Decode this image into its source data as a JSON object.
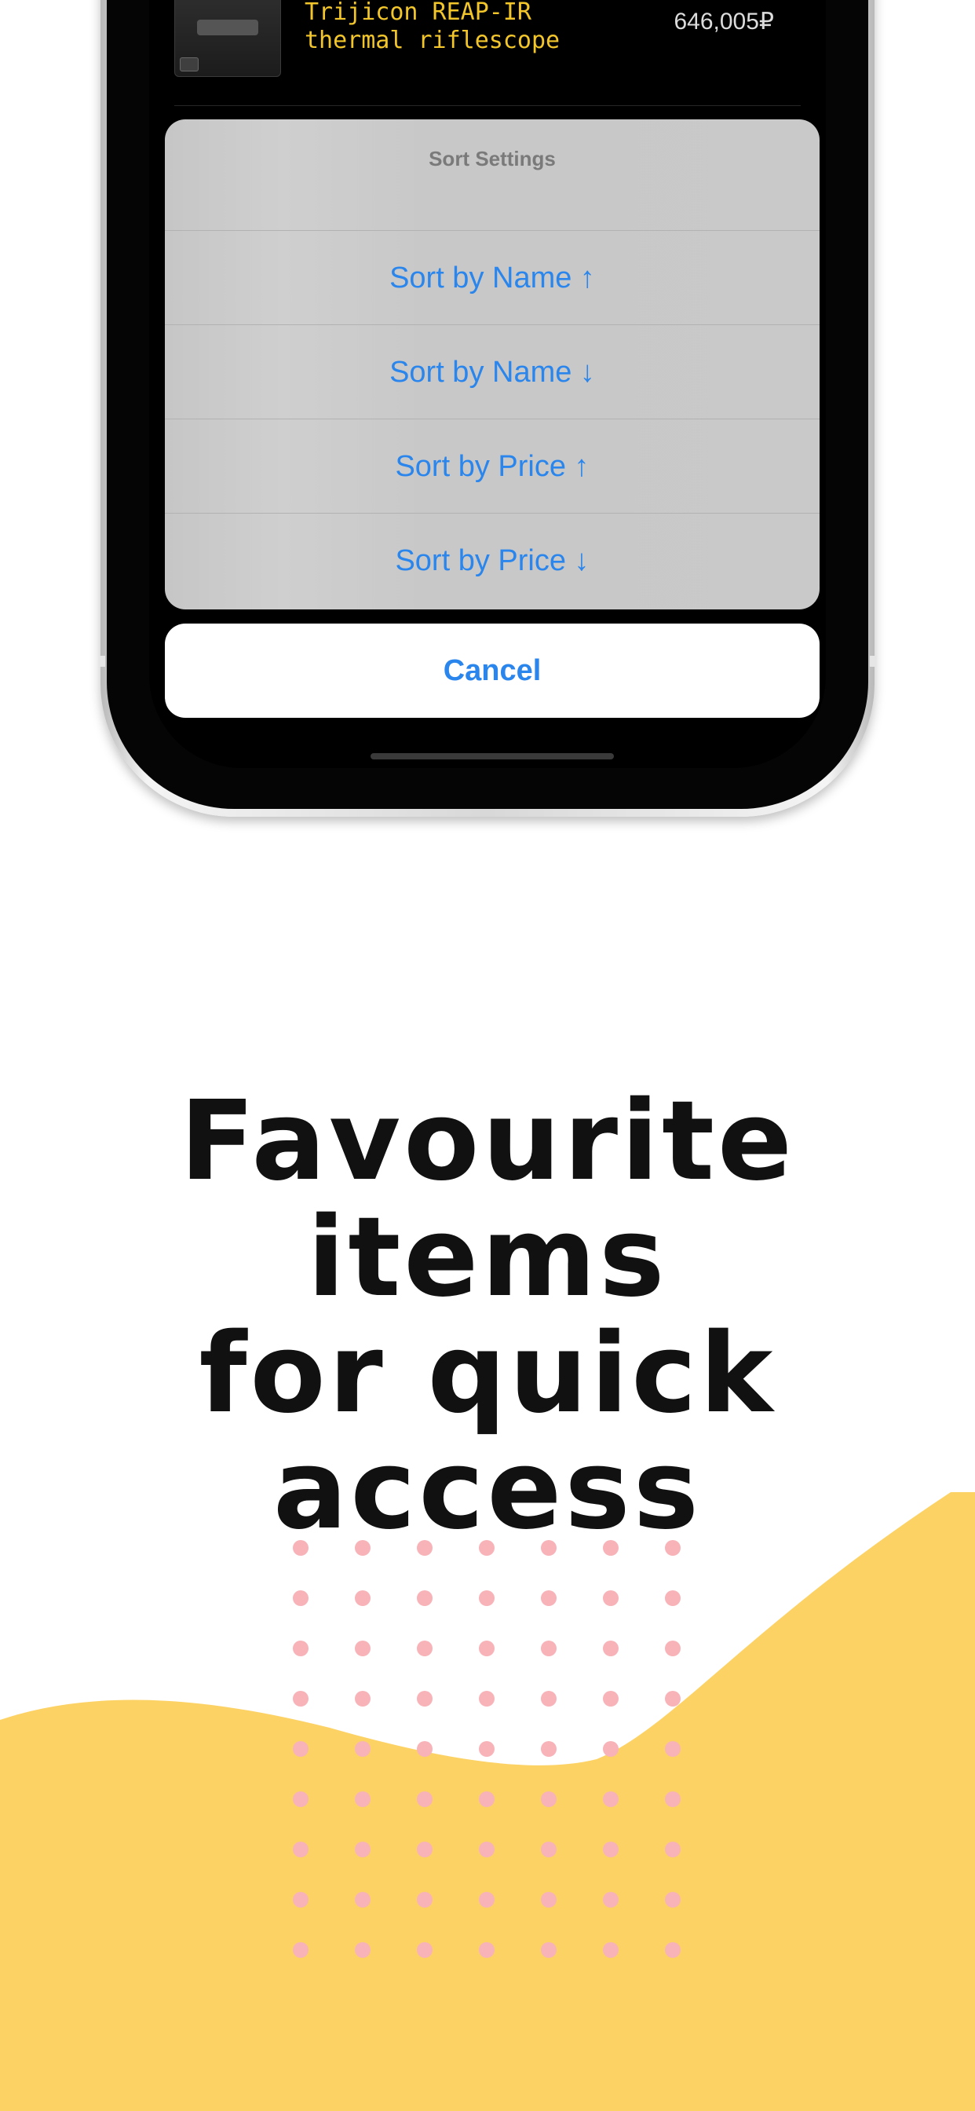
{
  "list_item": {
    "name": "Trijicon REAP-IR thermal riflescope",
    "price": "646,005₽"
  },
  "sort_sheet": {
    "title": "Sort Settings",
    "options": [
      "Sort by Name ↑",
      "Sort by Name ↓",
      "Sort by Price ↑",
      "Sort by Price ↓"
    ],
    "cancel_label": "Cancel"
  },
  "headline": {
    "line1": "Favourite items",
    "line2": "for quick access"
  },
  "colors": {
    "accent_blue": "#2a86ec",
    "item_name_yellow": "#f2c62b",
    "wave_yellow": "#fdd265",
    "dot_pink": "#f7b3b8"
  }
}
